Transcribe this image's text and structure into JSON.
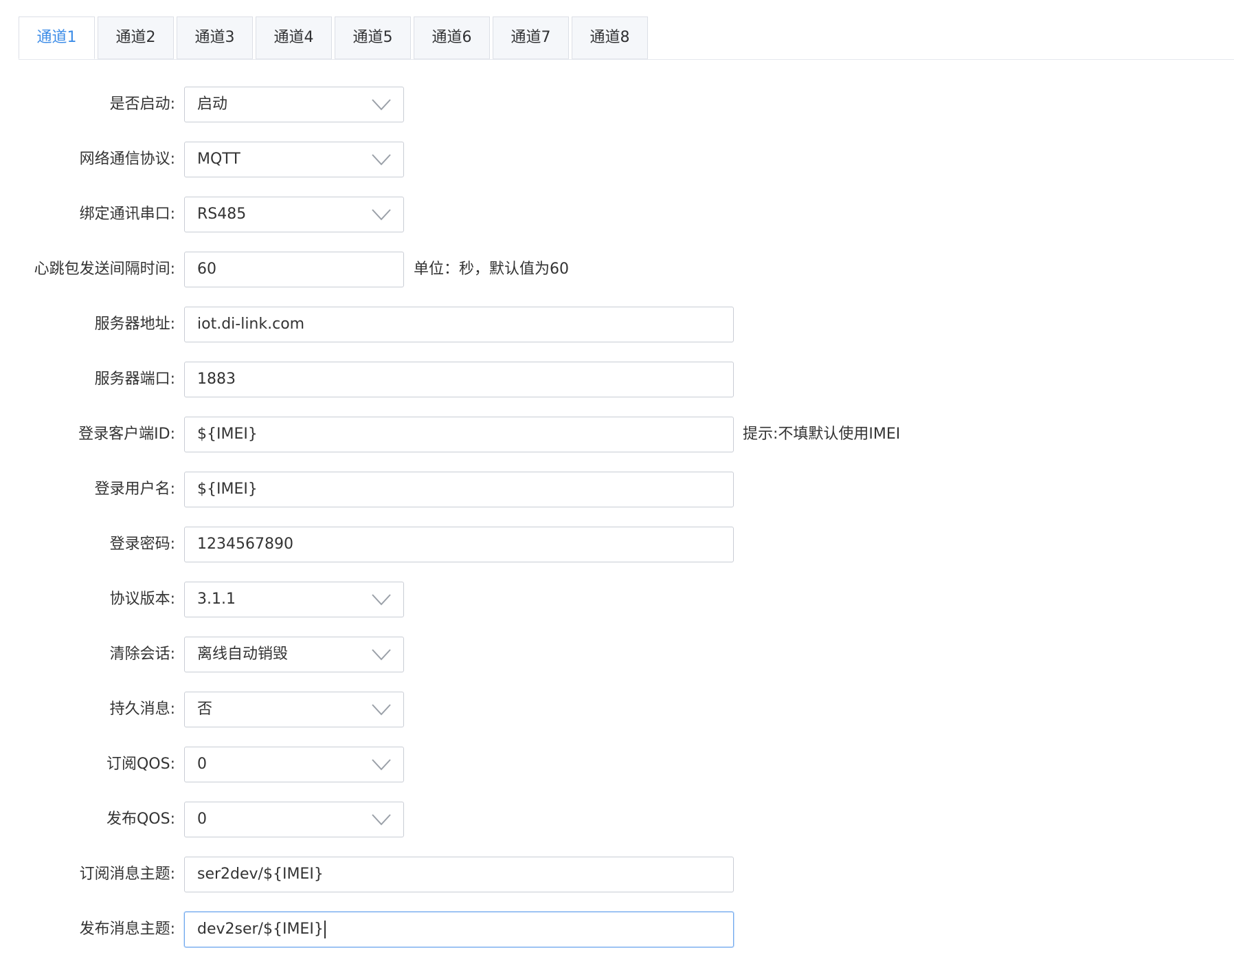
{
  "tabs": {
    "items": [
      "通道1",
      "通道2",
      "通道3",
      "通道4",
      "通道5",
      "通道6",
      "通道7",
      "通道8"
    ],
    "active": "通道1"
  },
  "form": {
    "enable": {
      "label": "是否启动:",
      "value": "启动"
    },
    "protocol": {
      "label": "网络通信协议:",
      "value": "MQTT"
    },
    "serial_port": {
      "label": "绑定通讯串口:",
      "value": "RS485"
    },
    "heartbeat": {
      "label": "心跳包发送间隔时间:",
      "value": "60",
      "hint": "单位：秒，默认值为60"
    },
    "server_address": {
      "label": "服务器地址:",
      "value": "iot.di-link.com"
    },
    "server_port": {
      "label": "服务器端口:",
      "value": "1883"
    },
    "client_id": {
      "label": "登录客户端ID:",
      "value": "${IMEI}",
      "hint": "提示:不填默认使用IMEI"
    },
    "username": {
      "label": "登录用户名:",
      "value": "${IMEI}"
    },
    "password": {
      "label": "登录密码:",
      "value": "1234567890"
    },
    "protocol_version": {
      "label": "协议版本:",
      "value": "3.1.1"
    },
    "clean_session": {
      "label": "清除会话:",
      "value": "离线自动销毁"
    },
    "retain": {
      "label": "持久消息:",
      "value": "否"
    },
    "subscribe_qos": {
      "label": "订阅QOS:",
      "value": "0"
    },
    "publish_qos": {
      "label": "发布QOS:",
      "value": "0"
    },
    "subscribe_topic": {
      "label": "订阅消息主题:",
      "value": "ser2dev/${IMEI}"
    },
    "publish_topic": {
      "label": "发布消息主题:",
      "value": "dev2ser/${IMEI}"
    }
  },
  "icons": {
    "dropdown": "chevron-down-icon"
  },
  "colors": {
    "active_tab": "#3c8ce7",
    "border": "#c8ccd4",
    "focus_border": "#6ea7ee"
  }
}
